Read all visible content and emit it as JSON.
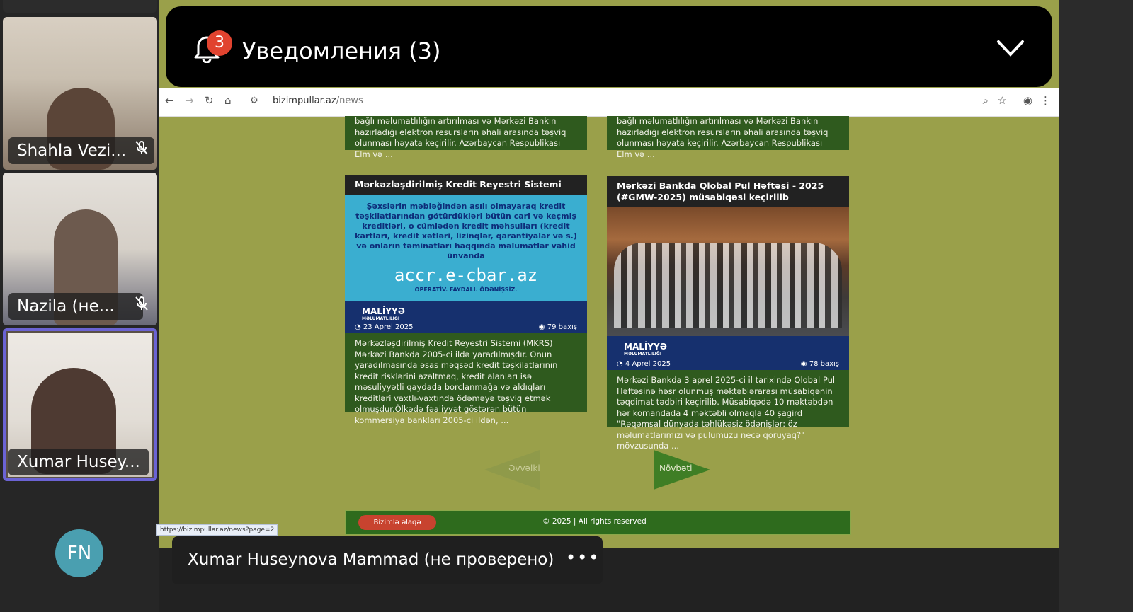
{
  "participants": [
    {
      "name": "Shahla Vezi...",
      "muted": true
    },
    {
      "name": "Nazila (не...",
      "muted": true
    },
    {
      "name": "Xumar Husey...",
      "muted": false,
      "active": true
    }
  ],
  "avatar_initials": "FN",
  "notifications": {
    "title": "Уведомления (3)",
    "badge": "3"
  },
  "browser": {
    "domain": "bizimpullar.az",
    "path": "/news"
  },
  "cards_top": [
    {
      "text": "bağlı məlumatlılığın artırılması və Mərkəzi Bankın hazırladığı elektron resursların əhali arasında təşviq olunması həyata keçirilir. Azərbaycan Respublikası Elm və ..."
    },
    {
      "text": "bağlı məlumatlılığın artırılması və Mərkəzi Bankın hazırladığı elektron resursların əhali arasında təşviq olunması həyata keçirilir. Azərbaycan Respublikası Elm və ..."
    }
  ],
  "card1": {
    "title": "Mərkəzləşdirilmiş Kredit Reyestri Sistemi",
    "promo_text": "Şəxslərin məbləğindən asılı olmayaraq kredit təşkilatlarından götürdükləri bütün cari və keçmiş kreditləri, o cümlədən kredit məhsulları (kredit kartları, kredit xətləri, lizinqlər, qarantiyalar və s.) və onların təminatları haqqında məlumatlar vahid ünvanda",
    "promo_url": "accr.e-cbar.az",
    "promo_tag": "OPERATİV. FAYDALI. ÖDƏNİŞSİZ.",
    "brand": "MALİYYƏ",
    "brand_sub": "MƏLUMATLILIĞI",
    "date": "23 Aprel 2025",
    "views": "79 baxış",
    "text": "Mərkəzləşdirilmiş Kredit Reyestri Sistemi (MKRS) Mərkəzi Bankda 2005-ci ildə yaradılmışdır. Onun yaradılmasında əsas məqsəd kredit təşkilatlarının kredit risklərini azaltmaq, kredit alanları isə məsuliyyətli qaydada borclanmağa və aldıqları kreditləri vaxtlı-vaxtında ödəməyə təşviq etmək olmuşdur.Ölkədə fəaliyyət göstərən bütün kommersiya bankları 2005-ci ildən, ..."
  },
  "card2": {
    "title": "Mərkəzi Bankda Qlobal Pul Həftəsi - 2025 (#GMW-2025) müsabiqəsi keçirilib",
    "brand": "MALİYYƏ",
    "brand_sub": "MƏLUMATLILIĞI",
    "date": "4 Aprel 2025",
    "views": "78 baxış",
    "text": "Mərkəzi Bankda 3 aprel 2025-ci il tarixində Qlobal Pul Həftəsinə həsr olunmuş məktəblərarası müsabiqənin təqdimat tədbiri keçirilib. Müsabiqədə 10 məktəbdən hər komandada 4 məktəbli olmaqla 40 şagird \"Rəqəmsal dünyada təhlükəsiz ödənişlər: öz məlumatlarımızı və pulumuzu necə qoruyaq?\" mövzusunda ..."
  },
  "pagination": {
    "prev": "Əvvəlki",
    "next": "Növbəti"
  },
  "footer": {
    "contact": "Bizimlə əlaqə",
    "copyright": "© 2025 | All rights reserved"
  },
  "status_url": "https://bizimpullar.az/news?page=2",
  "presenter": {
    "label": "Xumar Huseynova Mammad (не проверено)",
    "more": "•••"
  },
  "colors": {
    "page_bg": "#9aa04a",
    "card_bg": "#2f5a1e",
    "badge": "#e1432f",
    "active_outline": "#6b63d4"
  }
}
